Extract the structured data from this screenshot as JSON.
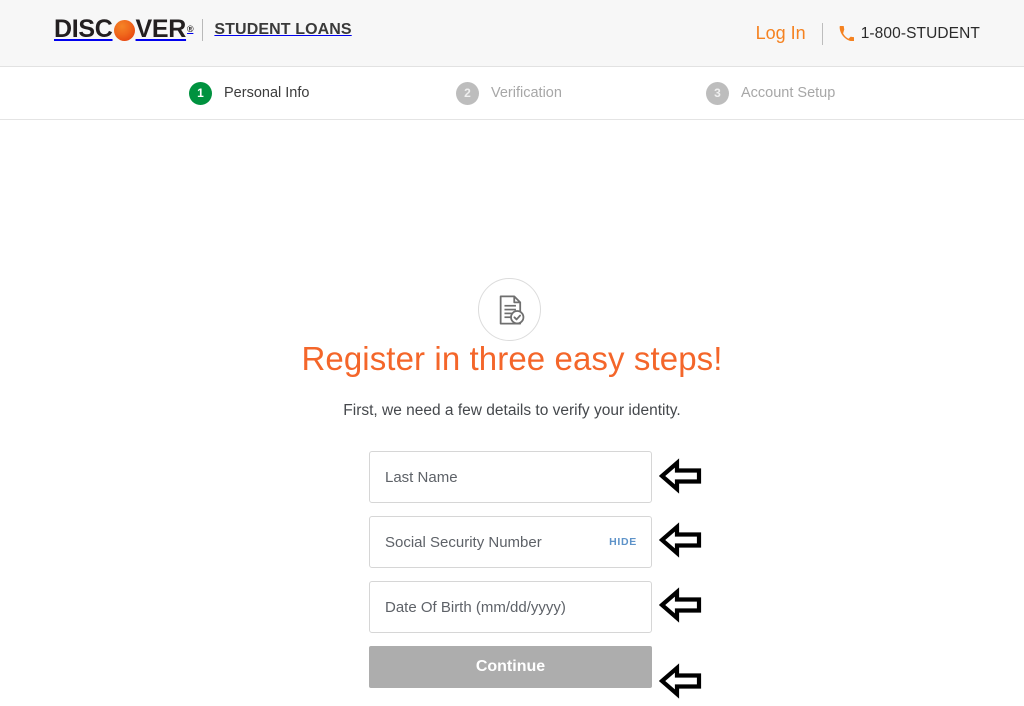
{
  "header": {
    "logo": {
      "brand_part1": "DISC",
      "brand_o_icon": "discover-orange-circle",
      "brand_part2": "VER",
      "registered_mark": "®",
      "product": "STUDENT LOANS"
    },
    "login_label": "Log In",
    "phone_icon": "phone-handset-icon",
    "phone_number": "1-800-STUDENT",
    "background_color": "#f7f7f7",
    "accent_color": "#f58220"
  },
  "steps": [
    {
      "number": "1",
      "label": "Personal Info",
      "state": "active"
    },
    {
      "number": "2",
      "label": "Verification",
      "state": "inactive"
    },
    {
      "number": "3",
      "label": "Account Setup",
      "state": "inactive"
    }
  ],
  "step_colors": {
    "active_badge": "#00923f",
    "inactive_badge": "#bdbdbd",
    "active_text": "#3c3c3c",
    "inactive_text": "#a7a7a7"
  },
  "main": {
    "icon_name": "document-check-icon",
    "headline": "Register in three easy steps!",
    "headline_color": "#f4662a",
    "subheadline": "First, we need a few details to verify your identity."
  },
  "form": {
    "fields": [
      {
        "name": "last-name",
        "placeholder": "Last Name",
        "value": "",
        "has_hide_toggle": false,
        "hide_label": ""
      },
      {
        "name": "social-security-number",
        "placeholder": "Social Security Number",
        "value": "",
        "has_hide_toggle": true,
        "hide_label": "HIDE"
      },
      {
        "name": "date-of-birth",
        "placeholder": "Date Of Birth (mm/dd/yyyy)",
        "value": "",
        "has_hide_toggle": false,
        "hide_label": ""
      }
    ],
    "submit_label": "Continue",
    "submit_state": "disabled",
    "submit_color": "#adadad"
  },
  "annotations": {
    "arrow_icon": "left-pointing-arrow-icon",
    "count": 4,
    "targets": [
      "last-name-field",
      "social-security-number-field",
      "date-of-birth-field",
      "continue-button"
    ]
  }
}
